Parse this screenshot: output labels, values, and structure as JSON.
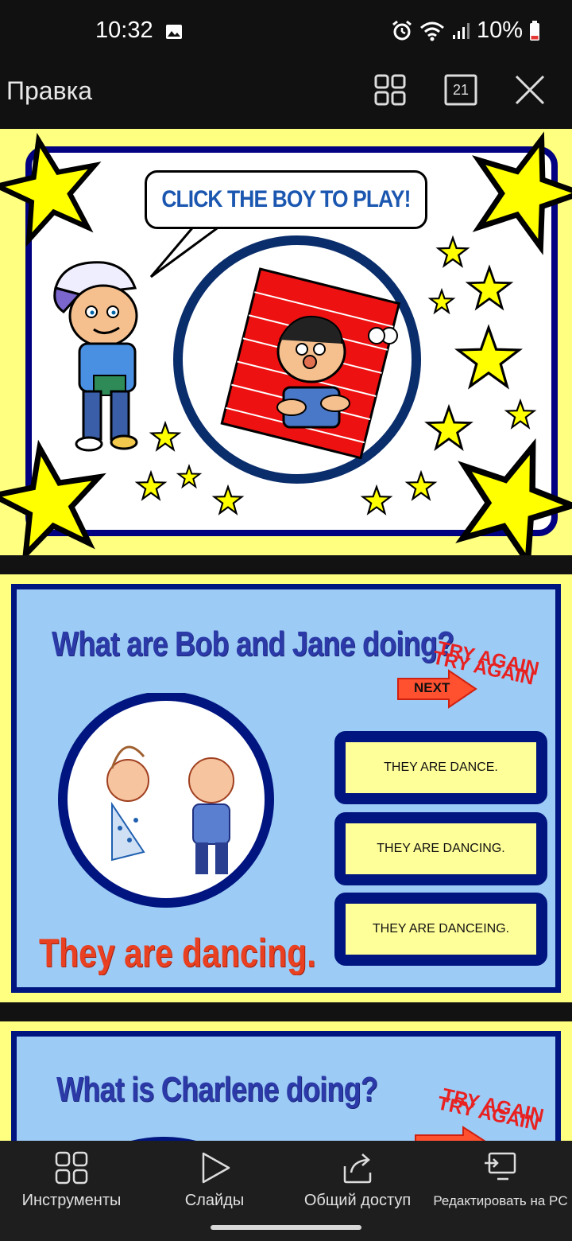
{
  "status": {
    "time": "10:32",
    "battery": "10%",
    "icons": [
      "image-icon",
      "alarm-icon",
      "wifi-icon",
      "signal-icon",
      "battery-low-icon"
    ]
  },
  "appbar": {
    "title": "Правка",
    "slide_count": "21",
    "icons": [
      "grid-view-icon",
      "slide-count-icon",
      "close-icon"
    ]
  },
  "slides": {
    "slide1": {
      "bubble_text": "CLICK THE BOY TO PLAY!"
    },
    "slide2": {
      "question": "What are Bob and Jane doing?",
      "try_again": "TRY AGAIN",
      "next_label": "NEXT",
      "answers": [
        "THEY ARE DANCE.",
        "THEY ARE DANCING.",
        "THEY ARE DANCEING."
      ],
      "caption": "They are dancing."
    },
    "slide3": {
      "question": "What is Charlene doing?",
      "try_again": "TRY AGAIN"
    }
  },
  "bottom_nav": {
    "tabs": [
      {
        "label": "Инструменты",
        "icon": "tools-icon"
      },
      {
        "label": "Слайды",
        "icon": "play-icon"
      },
      {
        "label": "Общий доступ",
        "icon": "share-icon"
      },
      {
        "label": "Редактировать на PC",
        "icon": "cast-to-pc-icon"
      }
    ]
  },
  "colors": {
    "slide_background": "#ffff80",
    "frame_navy": "#001580",
    "question_blue": "#2b3aa8",
    "answer_fill": "#ffff99",
    "try_again_red": "#e82020",
    "caption_orange": "#e84020",
    "bubble_text_blue": "#1b57b0"
  }
}
